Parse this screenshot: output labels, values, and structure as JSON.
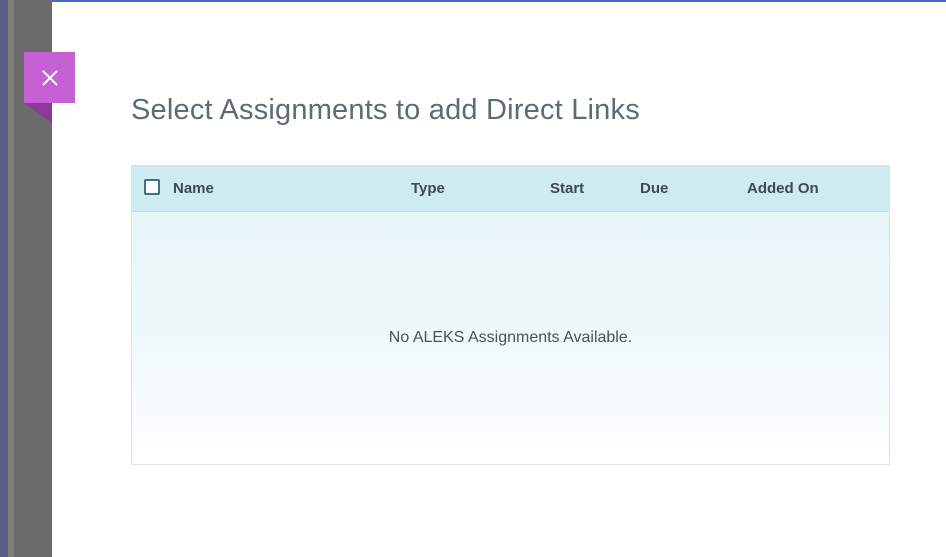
{
  "modal": {
    "close_icon": "close-icon",
    "title": "Select Assignments to add Direct Links"
  },
  "table": {
    "columns": [
      "Name",
      "Type",
      "Start",
      "Due",
      "Added On"
    ],
    "rows": [],
    "empty_message": "No ALEKS Assignments Available."
  },
  "colors": {
    "close_tab": "#c561d3",
    "header_bg": "#cdebf0",
    "modal_top_border": "#4a67c7"
  }
}
